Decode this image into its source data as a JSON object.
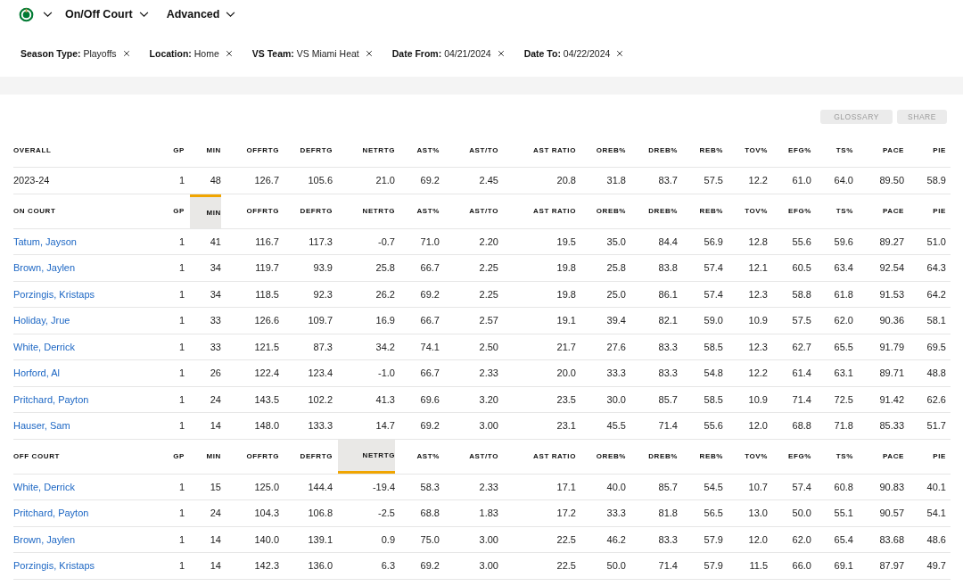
{
  "nav": {
    "dropdowns": [
      "On/Off Court",
      "Advanced"
    ]
  },
  "filters": [
    {
      "label": "Season Type:",
      "value": "Playoffs"
    },
    {
      "label": "Location:",
      "value": "Home"
    },
    {
      "label": "VS Team:",
      "value": "VS Miami Heat"
    },
    {
      "label": "Date From:",
      "value": "04/21/2024"
    },
    {
      "label": "Date To:",
      "value": "04/22/2024"
    }
  ],
  "actions": [
    "GLOSSARY",
    "SHARE"
  ],
  "sections": [
    {
      "title": "OVERALL",
      "columns": [
        {
          "label": "GP",
          "selected": false
        },
        {
          "label": "MIN",
          "selected": false
        },
        {
          "label": "OFFRTG",
          "selected": false
        },
        {
          "label": "DEFRTG",
          "selected": false
        },
        {
          "label": "NETRTG",
          "selected": false
        },
        {
          "label": "AST%",
          "selected": false
        },
        {
          "label": "AST/TO",
          "selected": false
        },
        {
          "label": "AST RATIO",
          "selected": false
        },
        {
          "label": "OREB%",
          "selected": false
        },
        {
          "label": "DREB%",
          "selected": false
        },
        {
          "label": "REB%",
          "selected": false
        },
        {
          "label": "TOV%",
          "selected": false
        },
        {
          "label": "EFG%",
          "selected": false
        },
        {
          "label": "TS%",
          "selected": false
        },
        {
          "label": "PACE",
          "selected": false
        },
        {
          "label": "PIE",
          "selected": false
        }
      ],
      "rows": [
        {
          "kind": "season",
          "name": "2023-24",
          "cells": [
            "1",
            "48",
            "126.7",
            "105.6",
            "21.0",
            "69.2",
            "2.45",
            "20.8",
            "31.8",
            "83.7",
            "57.5",
            "12.2",
            "61.0",
            "64.0",
            "89.50",
            "58.9"
          ]
        }
      ]
    },
    {
      "title": "ON COURT",
      "sort_ascending": false,
      "columns": [
        {
          "label": "GP",
          "selected": false
        },
        {
          "label": "MIN",
          "selected": true
        },
        {
          "label": "OFFRTG",
          "selected": false
        },
        {
          "label": "DEFRTG",
          "selected": false
        },
        {
          "label": "NETRTG",
          "selected": false
        },
        {
          "label": "AST%",
          "selected": false
        },
        {
          "label": "AST/TO",
          "selected": false
        },
        {
          "label": "AST RATIO",
          "selected": false
        },
        {
          "label": "OREB%",
          "selected": false
        },
        {
          "label": "DREB%",
          "selected": false
        },
        {
          "label": "REB%",
          "selected": false
        },
        {
          "label": "TOV%",
          "selected": false
        },
        {
          "label": "EFG%",
          "selected": false
        },
        {
          "label": "TS%",
          "selected": false
        },
        {
          "label": "PACE",
          "selected": false
        },
        {
          "label": "PIE",
          "selected": false
        }
      ],
      "rows": [
        {
          "kind": "player",
          "name": "Tatum, Jayson",
          "cells": [
            "1",
            "41",
            "116.7",
            "117.3",
            "-0.7",
            "71.0",
            "2.20",
            "19.5",
            "35.0",
            "84.4",
            "56.9",
            "12.8",
            "55.6",
            "59.6",
            "89.27",
            "51.0"
          ]
        },
        {
          "kind": "player",
          "name": "Brown, Jaylen",
          "cells": [
            "1",
            "34",
            "119.7",
            "93.9",
            "25.8",
            "66.7",
            "2.25",
            "19.8",
            "25.8",
            "83.8",
            "57.4",
            "12.1",
            "60.5",
            "63.4",
            "92.54",
            "64.3"
          ]
        },
        {
          "kind": "player",
          "name": "Porzingis, Kristaps",
          "cells": [
            "1",
            "34",
            "118.5",
            "92.3",
            "26.2",
            "69.2",
            "2.25",
            "19.8",
            "25.0",
            "86.1",
            "57.4",
            "12.3",
            "58.8",
            "61.8",
            "91.53",
            "64.2"
          ]
        },
        {
          "kind": "player",
          "name": "Holiday, Jrue",
          "cells": [
            "1",
            "33",
            "126.6",
            "109.7",
            "16.9",
            "66.7",
            "2.57",
            "19.1",
            "39.4",
            "82.1",
            "59.0",
            "10.9",
            "57.5",
            "62.0",
            "90.36",
            "58.1"
          ]
        },
        {
          "kind": "player",
          "name": "White, Derrick",
          "cells": [
            "1",
            "33",
            "121.5",
            "87.3",
            "34.2",
            "74.1",
            "2.50",
            "21.7",
            "27.6",
            "83.3",
            "58.5",
            "12.3",
            "62.7",
            "65.5",
            "91.79",
            "69.5"
          ]
        },
        {
          "kind": "player",
          "name": "Horford, Al",
          "cells": [
            "1",
            "26",
            "122.4",
            "123.4",
            "-1.0",
            "66.7",
            "2.33",
            "20.0",
            "33.3",
            "83.3",
            "54.8",
            "12.2",
            "61.4",
            "63.1",
            "89.71",
            "48.8"
          ]
        },
        {
          "kind": "player",
          "name": "Pritchard, Payton",
          "cells": [
            "1",
            "24",
            "143.5",
            "102.2",
            "41.3",
            "69.6",
            "3.20",
            "23.5",
            "30.0",
            "85.7",
            "58.5",
            "10.9",
            "71.4",
            "72.5",
            "91.42",
            "62.6"
          ]
        },
        {
          "kind": "player",
          "name": "Hauser, Sam",
          "cells": [
            "1",
            "14",
            "148.0",
            "133.3",
            "14.7",
            "69.2",
            "3.00",
            "23.1",
            "45.5",
            "71.4",
            "55.6",
            "12.0",
            "68.8",
            "71.8",
            "85.33",
            "51.7"
          ]
        }
      ]
    },
    {
      "title": "OFF COURT",
      "sort_ascending": true,
      "columns": [
        {
          "label": "GP",
          "selected": false
        },
        {
          "label": "MIN",
          "selected": false
        },
        {
          "label": "OFFRTG",
          "selected": false
        },
        {
          "label": "DEFRTG",
          "selected": false
        },
        {
          "label": "NETRTG",
          "selected": true
        },
        {
          "label": "AST%",
          "selected": false
        },
        {
          "label": "AST/TO",
          "selected": false
        },
        {
          "label": "AST RATIO",
          "selected": false
        },
        {
          "label": "OREB%",
          "selected": false
        },
        {
          "label": "DREB%",
          "selected": false
        },
        {
          "label": "REB%",
          "selected": false
        },
        {
          "label": "TOV%",
          "selected": false
        },
        {
          "label": "EFG%",
          "selected": false
        },
        {
          "label": "TS%",
          "selected": false
        },
        {
          "label": "PACE",
          "selected": false
        },
        {
          "label": "PIE",
          "selected": false
        }
      ],
      "rows": [
        {
          "kind": "player",
          "name": "White, Derrick",
          "cells": [
            "1",
            "15",
            "125.0",
            "144.4",
            "-19.4",
            "58.3",
            "2.33",
            "17.1",
            "40.0",
            "85.7",
            "54.5",
            "10.7",
            "57.4",
            "60.8",
            "90.83",
            "40.1"
          ]
        },
        {
          "kind": "player",
          "name": "Pritchard, Payton",
          "cells": [
            "1",
            "24",
            "104.3",
            "106.8",
            "-2.5",
            "68.8",
            "1.83",
            "17.2",
            "33.3",
            "81.8",
            "56.5",
            "13.0",
            "50.0",
            "55.1",
            "90.57",
            "54.1"
          ]
        },
        {
          "kind": "player",
          "name": "Brown, Jaylen",
          "cells": [
            "1",
            "14",
            "140.0",
            "139.1",
            "0.9",
            "75.0",
            "3.00",
            "22.5",
            "46.2",
            "83.3",
            "57.9",
            "12.0",
            "62.0",
            "65.4",
            "83.68",
            "48.6"
          ]
        },
        {
          "kind": "player",
          "name": "Porzingis, Kristaps",
          "cells": [
            "1",
            "14",
            "142.3",
            "136.0",
            "6.3",
            "69.2",
            "3.00",
            "22.5",
            "50.0",
            "71.4",
            "57.9",
            "11.5",
            "66.0",
            "69.1",
            "87.97",
            "49.7"
          ]
        }
      ]
    }
  ]
}
